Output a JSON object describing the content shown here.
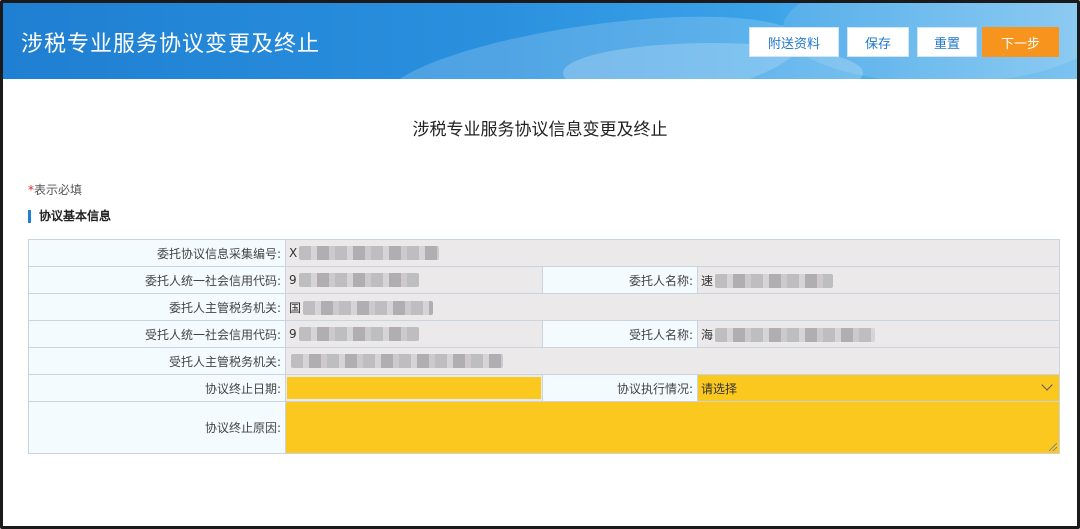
{
  "header": {
    "title": "涉税专业服务协议变更及终止",
    "buttons": {
      "attach": "附送资料",
      "save": "保存",
      "reset": "重置",
      "next": "下一步"
    }
  },
  "main": {
    "page_title": "涉税专业服务协议信息变更及终止",
    "required_star": "*",
    "required_note": "表示必填",
    "section_title": "协议基本信息"
  },
  "form": {
    "agreement_no_label": "委托协议信息采集编号:",
    "agreement_no_prefix": "X",
    "principal_credit_code_label": "委托人统一社会信用代码:",
    "principal_credit_code_prefix": "9",
    "principal_name_label": "委托人名称:",
    "principal_name_prefix": "速",
    "principal_tax_office_label": "委托人主管税务机关:",
    "principal_tax_office_prefix": "国",
    "agent_credit_code_label": "受托人统一社会信用代码:",
    "agent_credit_code_prefix": "9",
    "agent_name_label": "受托人名称:",
    "agent_name_prefix": "海",
    "agent_tax_office_label": "受托人主管税务机关:",
    "agent_tax_office_prefix": "",
    "end_date_label": "协议终止日期:",
    "end_date_value": "",
    "execution_label": "协议执行情况:",
    "execution_value": "请选择",
    "end_reason_label": "协议终止原因:",
    "end_reason_value": ""
  },
  "colors": {
    "header_blue": "#1f7fd2",
    "next_button": "#f7941d",
    "required_field": "#fbc81f",
    "required_star": "#e0281e"
  }
}
